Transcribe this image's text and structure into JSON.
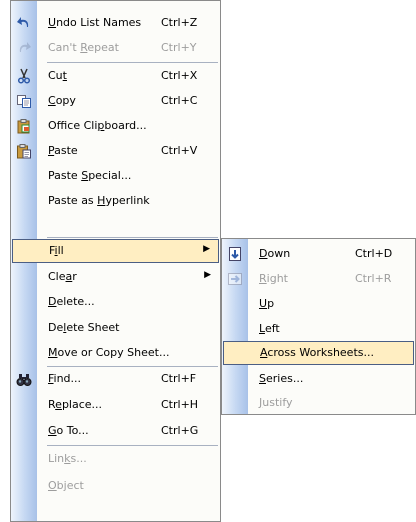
{
  "edit_menu": {
    "undo": {
      "pre": "",
      "key": "U",
      "post": "ndo List Names",
      "shortcut": "Ctrl+Z"
    },
    "repeat": {
      "pre": "Can't ",
      "key": "R",
      "post": "epeat",
      "shortcut": "Ctrl+Y"
    },
    "cut": {
      "pre": "Cu",
      "key": "t",
      "post": "",
      "shortcut": "Ctrl+X"
    },
    "copy": {
      "pre": "",
      "key": "C",
      "post": "opy",
      "shortcut": "Ctrl+C"
    },
    "office_clipboard": {
      "pre": "Office Cli",
      "key": "p",
      "post": "board...",
      "shortcut": ""
    },
    "paste": {
      "pre": "",
      "key": "P",
      "post": "aste",
      "shortcut": "Ctrl+V"
    },
    "paste_special": {
      "pre": "Paste ",
      "key": "S",
      "post": "pecial...",
      "shortcut": ""
    },
    "paste_hyperlink": {
      "pre": "Paste as ",
      "key": "H",
      "post": "yperlink",
      "shortcut": ""
    },
    "fill": {
      "pre": "F",
      "key": "i",
      "post": "ll",
      "shortcut": ""
    },
    "clear": {
      "pre": "Cle",
      "key": "a",
      "post": "r",
      "shortcut": ""
    },
    "delete": {
      "pre": "",
      "key": "D",
      "post": "elete...",
      "shortcut": ""
    },
    "delete_sheet": {
      "pre": "De",
      "key": "l",
      "post": "ete Sheet",
      "shortcut": ""
    },
    "move_copy_sheet": {
      "pre": "",
      "key": "M",
      "post": "ove or Copy Sheet...",
      "shortcut": ""
    },
    "find": {
      "pre": "",
      "key": "F",
      "post": "ind...",
      "shortcut": "Ctrl+F"
    },
    "replace": {
      "pre": "R",
      "key": "e",
      "post": "place...",
      "shortcut": "Ctrl+H"
    },
    "goto": {
      "pre": "",
      "key": "G",
      "post": "o To...",
      "shortcut": "Ctrl+G"
    },
    "links": {
      "pre": "Lin",
      "key": "k",
      "post": "s...",
      "shortcut": ""
    },
    "object": {
      "pre": "",
      "key": "O",
      "post": "bject",
      "shortcut": ""
    }
  },
  "fill_submenu": {
    "down": {
      "pre": "",
      "key": "D",
      "post": "own",
      "shortcut": "Ctrl+D"
    },
    "right": {
      "pre": "",
      "key": "R",
      "post": "ight",
      "shortcut": "Ctrl+R"
    },
    "up": {
      "pre": "",
      "key": "U",
      "post": "p",
      "shortcut": ""
    },
    "left": {
      "pre": "",
      "key": "L",
      "post": "eft",
      "shortcut": ""
    },
    "across_worksheets": {
      "pre": "",
      "key": "A",
      "post": "cross Worksheets...",
      "shortcut": ""
    },
    "series": {
      "pre": "",
      "key": "S",
      "post": "eries...",
      "shortcut": ""
    },
    "justify": {
      "pre": "",
      "key": "J",
      "post": "ustify",
      "shortcut": ""
    }
  },
  "submenu_arrow": "▶",
  "icons": {
    "undo": "undo-icon",
    "repeat": "redo-icon",
    "cut": "scissors-icon",
    "copy": "copy-icon",
    "office_clipboard": "clipboard-icon",
    "paste": "paste-icon",
    "find": "binoculars-icon",
    "fill_down": "fill-down-icon",
    "fill_right": "fill-right-icon"
  },
  "colors": {
    "highlight_bg": "#ffeec2",
    "highlight_border": "#4b5e84",
    "gutter": "#c4d7f2",
    "disabled_text": "#9d9d9d"
  }
}
